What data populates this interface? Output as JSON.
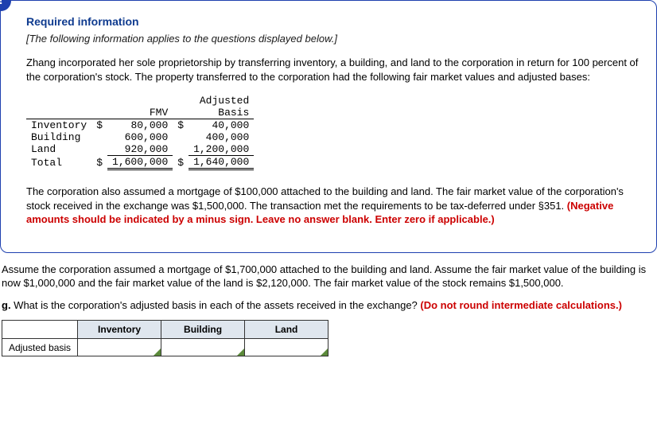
{
  "badge_icon": "!",
  "card": {
    "req_title": "Required information",
    "italic_note": "[The following information applies to the questions displayed below.]",
    "intro": "Zhang incorporated her sole proprietorship by transferring inventory, a building, and land to the corporation in return for 100 percent of the corporation's stock. The property transferred to the corporation had the following fair market values and adjusted bases:",
    "table": {
      "hdr_fmv": "FMV",
      "hdr_ab": "Adjusted\nBasis",
      "rows": [
        {
          "label": "Inventory",
          "d1": "$",
          "fmv": "80,000",
          "d2": "$",
          "ab": "40,000"
        },
        {
          "label": "Building",
          "d1": "",
          "fmv": "600,000",
          "d2": "",
          "ab": "400,000"
        },
        {
          "label": "Land",
          "d1": "",
          "fmv": "920,000",
          "d2": "",
          "ab": "1,200,000"
        }
      ],
      "total_label": "Total",
      "total_d1": "$",
      "total_fmv": "1,600,000",
      "total_d2": "$",
      "total_ab": "1,640,000"
    },
    "p2a": "The corporation also assumed a mortgage of $100,000 attached to the building and land. The fair market value of the corporation's stock received in the exchange was $1,500,000. The transaction met the requirements to be tax-deferred under §351. ",
    "p2b": "(Negative amounts should be indicated by a minus sign. Leave no answer blank. Enter zero if applicable.)"
  },
  "outer": {
    "assume": "Assume the corporation assumed a mortgage of $1,700,000 attached to the building and land. Assume the fair market value of the building is now $1,000,000 and the fair market value of the land is $2,120,000. The fair market value of the stock remains $1,500,000.",
    "q_prefix": "g. ",
    "q_body": "What is the corporation's adjusted basis in each of the assets received in the exchange? ",
    "q_red": "(Do not round intermediate calculations.)"
  },
  "answer": {
    "row_label": "Adjusted basis",
    "cols": {
      "c1": "Inventory",
      "c2": "Building",
      "c3": "Land"
    }
  }
}
